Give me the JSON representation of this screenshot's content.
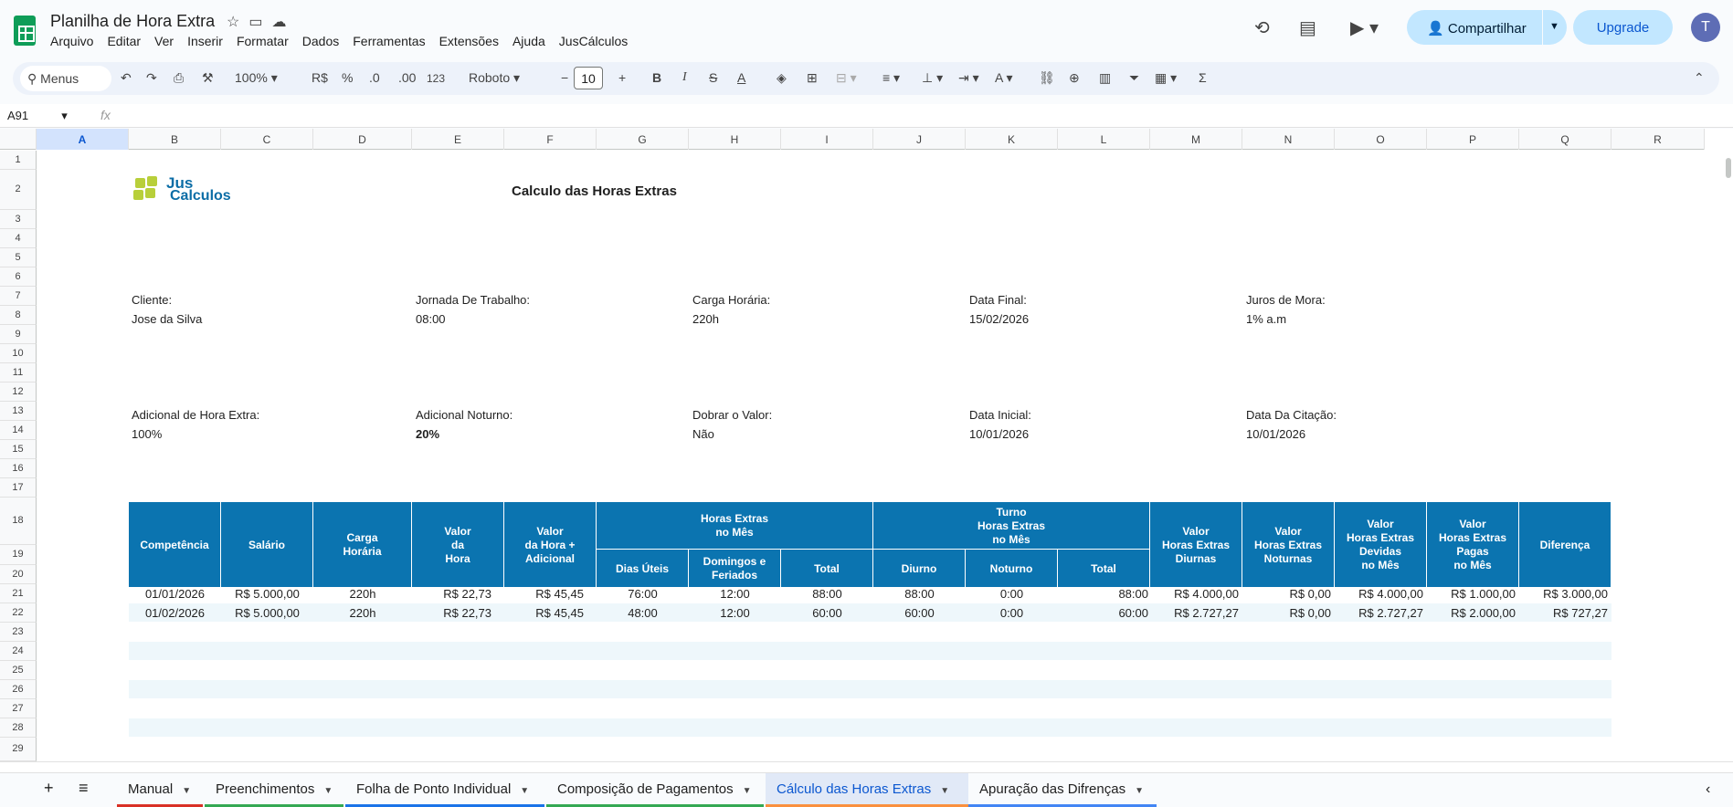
{
  "app": {
    "title": "Planilha de Hora Extra",
    "menu": [
      "Arquivo",
      "Editar",
      "Ver",
      "Inserir",
      "Formatar",
      "Dados",
      "Ferramentas",
      "Extensões",
      "Ajuda",
      "JusCálculos"
    ],
    "share_label": "Compartilhar",
    "upgrade_label": "Upgrade",
    "avatar_letter": "T"
  },
  "toolbar": {
    "search_label": "Menus",
    "zoom": "100%",
    "currency": "R$",
    "percent": "%",
    "dec_less": ".0",
    "dec_more": ".00",
    "number_format": "123",
    "font": "Roboto",
    "font_size": "10"
  },
  "formula_bar": {
    "cell_ref": "A91",
    "fx": "fx"
  },
  "columns": [
    "A",
    "B",
    "C",
    "D",
    "E",
    "F",
    "G",
    "H",
    "I",
    "J",
    "K",
    "L",
    "M",
    "N",
    "O",
    "P",
    "Q",
    "R"
  ],
  "rows": [
    "1",
    "2",
    "3",
    "4",
    "5",
    "6",
    "7",
    "8",
    "9",
    "10",
    "11",
    "12",
    "13",
    "14",
    "15",
    "16",
    "17",
    "18",
    "19",
    "20",
    "21",
    "22",
    "23",
    "24",
    "25",
    "26",
    "27",
    "28",
    "29"
  ],
  "sheet": {
    "logo_text1": "Jus",
    "logo_text2": "Calculos",
    "title": "Calculo das Horas Extras",
    "fields1": [
      {
        "label": "Cliente:",
        "value": "Jose da Silva"
      },
      {
        "label": "Jornada De Trabalho:",
        "value": "08:00"
      },
      {
        "label": "Carga Horária:",
        "value": "220h"
      },
      {
        "label": "Data Final:",
        "value": "15/02/2026"
      },
      {
        "label": "Juros de Mora:",
        "value": "1% a.m"
      }
    ],
    "fields2": [
      {
        "label": "Adicional de Hora Extra:",
        "value": "100%"
      },
      {
        "label": "Adicional Noturno:",
        "value": "20%"
      },
      {
        "label": "Dobrar o Valor:",
        "value": "Não"
      },
      {
        "label": "Data Inicial:",
        "value": "10/01/2026"
      },
      {
        "label": "Data Da Citação:",
        "value": "10/01/2026"
      }
    ]
  },
  "table": {
    "headers": {
      "competencia": "Competência",
      "salario": "Salário",
      "carga": "Carga\nHorária",
      "valor_hora": "Valor\nda\nHora",
      "valor_hora_adic": "Valor\nda Hora +\nAdicional",
      "he_mes": "Horas Extras\nno Mês",
      "dias_uteis": "Dias Úteis",
      "domingos": "Domingos e\nFeriados",
      "total1": "Total",
      "turno": "Turno\nHoras Extras\nno Mês",
      "diurno": "Diurno",
      "noturno": "Noturno",
      "total2": "Total",
      "v_diurnas": "Valor\nHoras Extras\nDiurnas",
      "v_noturnas": "Valor\nHoras Extras\nNoturnas",
      "v_devidas": "Valor\nHoras Extras\nDevidas\nno Mês",
      "v_pagas": "Valor\nHoras Extras\nPagas\nno Mês",
      "diferenca": "Diferença"
    },
    "rows": [
      [
        "01/01/2026",
        "R$ 5.000,00",
        "220h",
        "R$ 22,73",
        "R$ 45,45",
        "76:00",
        "12:00",
        "88:00",
        "88:00",
        "0:00",
        "88:00",
        "R$ 4.000,00",
        "R$ 0,00",
        "R$ 4.000,00",
        "R$ 1.000,00",
        "R$ 3.000,00"
      ],
      [
        "01/02/2026",
        "R$ 5.000,00",
        "220h",
        "R$ 22,73",
        "R$ 45,45",
        "48:00",
        "12:00",
        "60:00",
        "60:00",
        "0:00",
        "60:00",
        "R$ 2.727,27",
        "R$ 0,00",
        "R$ 2.727,27",
        "R$ 2.000,00",
        "R$ 727,27"
      ]
    ]
  },
  "tabs": [
    {
      "label": "Manual",
      "color": "#d93025"
    },
    {
      "label": "Preenchimentos",
      "color": "#34a853"
    },
    {
      "label": "Folha de Ponto Individual",
      "color": "#1a73e8"
    },
    {
      "label": "Composição de Pagamentos",
      "color": "#34a853"
    },
    {
      "label": "Cálculo das Horas Extras",
      "color": "#fa903e",
      "active": true
    },
    {
      "label": "Apuração das Difrenças",
      "color": "#4285f4"
    }
  ]
}
